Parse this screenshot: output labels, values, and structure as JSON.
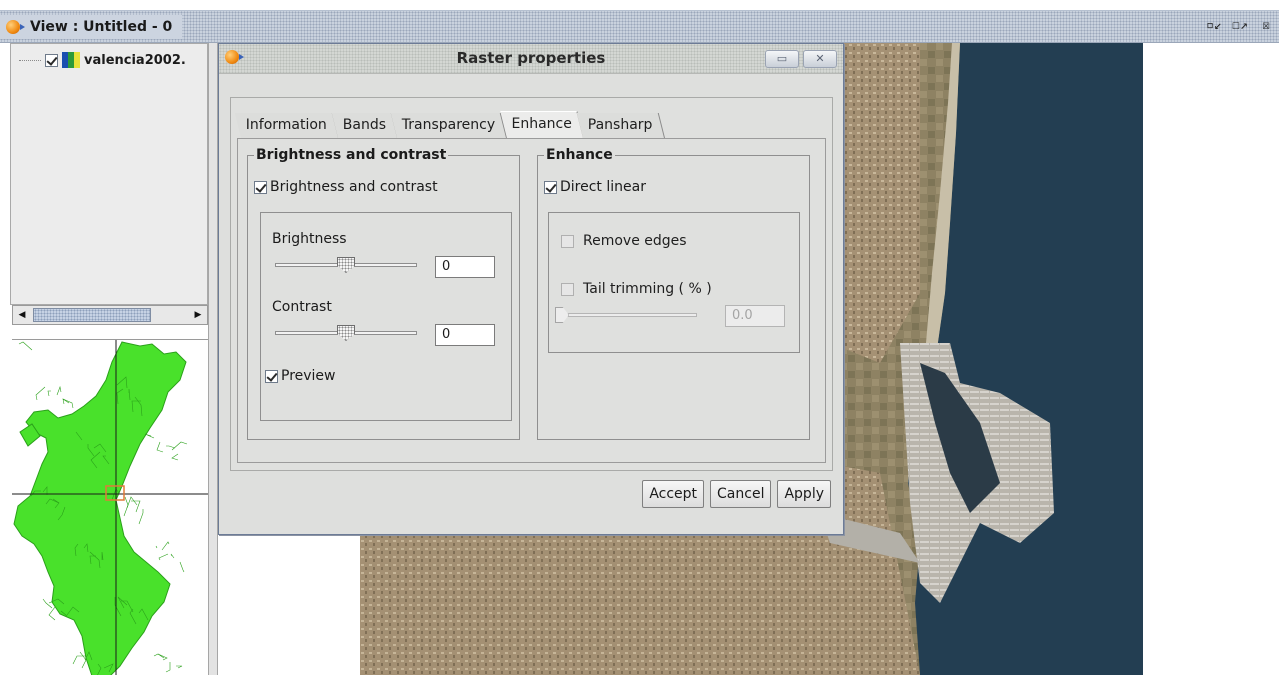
{
  "view": {
    "title": "View : Untitled - 0",
    "window_buttons": [
      "restore-icon",
      "maximize-icon",
      "close-icon"
    ]
  },
  "toc": {
    "layer": {
      "name": "valencia2002.",
      "checked": true,
      "swatch_colors": [
        "#1a4fb0",
        "#2c9a3a",
        "#e8e23a"
      ]
    }
  },
  "dialog": {
    "title": "Raster properties",
    "tabs": [
      {
        "label": "Information",
        "active": false
      },
      {
        "label": "Bands",
        "active": false
      },
      {
        "label": "Transparency",
        "active": false
      },
      {
        "label": "Enhance",
        "active": true
      },
      {
        "label": "Pansharp",
        "active": false
      }
    ],
    "brightness_contrast": {
      "legend": "Brightness and contrast",
      "enable_label": "Brightness and contrast",
      "enable_checked": true,
      "brightness_label": "Brightness",
      "brightness_value": "0",
      "contrast_label": "Contrast",
      "contrast_value": "0",
      "preview_label": "Preview",
      "preview_checked": true
    },
    "enhance": {
      "legend": "Enhance",
      "direct_linear_label": "Direct linear",
      "direct_linear_checked": true,
      "remove_edges_label": "Remove edges",
      "remove_edges_checked": false,
      "tail_trimming_label": "Tail trimming ( % )",
      "tail_trimming_checked": false,
      "tail_value": "0.0"
    },
    "buttons": {
      "accept": "Accept",
      "cancel": "Cancel",
      "apply": "Apply"
    }
  },
  "colors": {
    "sea": "#233e52",
    "land": "#9b8a6c",
    "locator_fill": "#49e12b",
    "locator_stroke": "#2aa01a",
    "locator_extent": "#e07a3a"
  }
}
